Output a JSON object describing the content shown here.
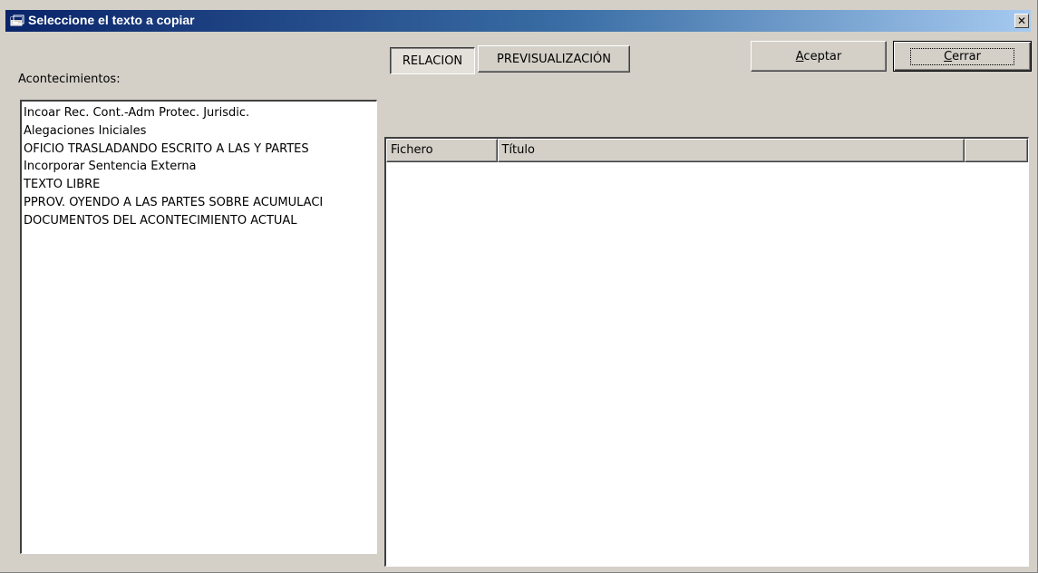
{
  "window": {
    "title": "Seleccione el texto a copiar",
    "close_label": "×"
  },
  "colors": {
    "titlebar_start": "#0a246a",
    "titlebar_end": "#a6caf0",
    "face": "#d4d0c8"
  },
  "icons": {
    "app": "window-app-icon",
    "close": "close-icon"
  },
  "events_label": "Acontecimientos:",
  "tabs": [
    {
      "label": "RELACION",
      "selected": true
    },
    {
      "label": "PREVISUALIZACIÓN",
      "selected": false
    }
  ],
  "buttons": {
    "accept_first": "A",
    "accept_rest": "ceptar",
    "close_first": "C",
    "close_rest": "errar"
  },
  "events": [
    "Incoar Rec. Cont.-Adm Protec. Jurisdic.",
    "Alegaciones Iniciales",
    "OFICIO TRASLADANDO ESCRITO A LAS Y PARTES",
    "Incorporar Sentencia Externa",
    "TEXTO LIBRE",
    "PPROV. OYENDO A LAS PARTES SOBRE ACUMULACI",
    "DOCUMENTOS DEL ACONTECIMIENTO ACTUAL"
  ],
  "files_table": {
    "columns": [
      "Fichero",
      "Título",
      ""
    ],
    "rows": []
  }
}
